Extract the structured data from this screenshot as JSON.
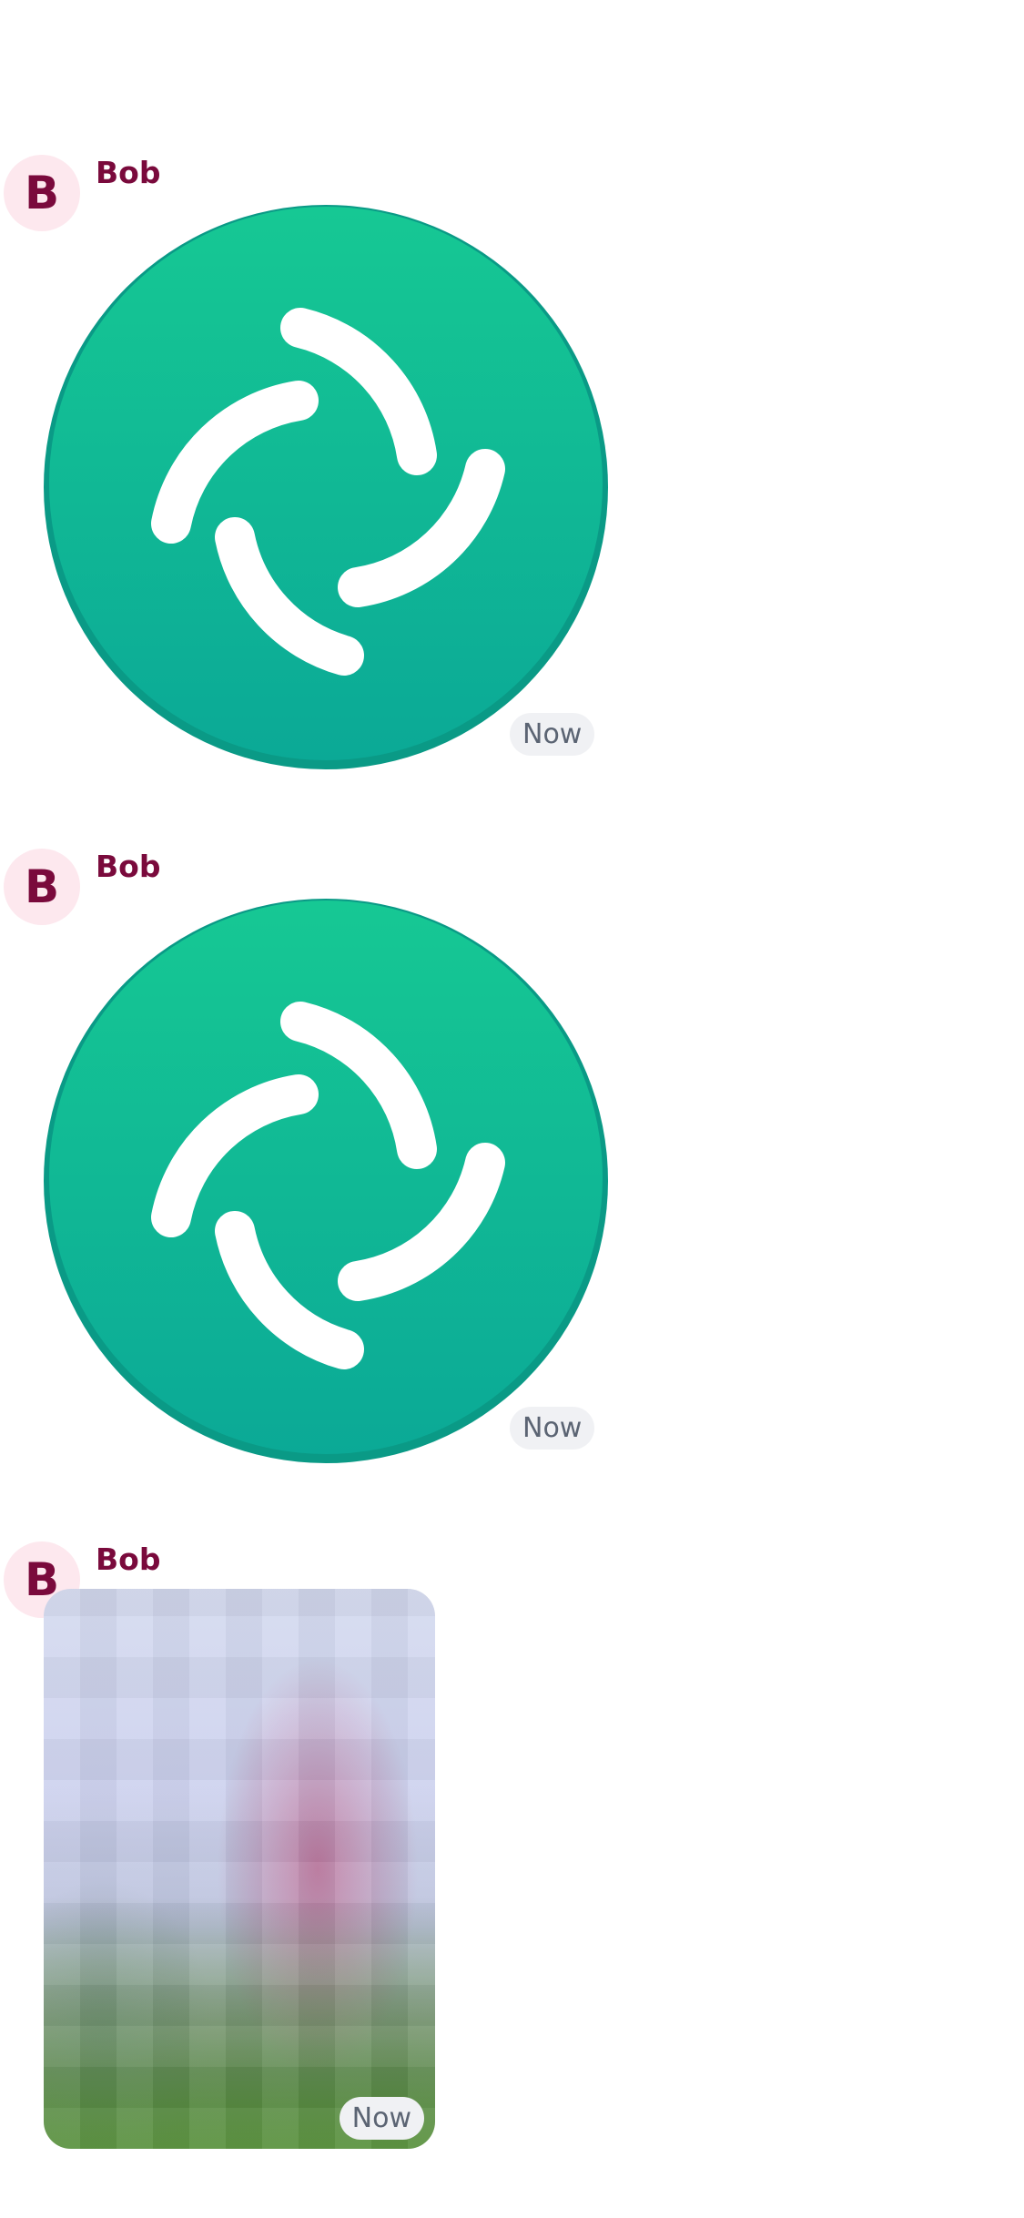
{
  "messages": [
    {
      "sender_initial": "B",
      "sender_name": "Bob",
      "kind": "logo",
      "time": "Now"
    },
    {
      "sender_initial": "B",
      "sender_name": "Bob",
      "kind": "logo",
      "time": "Now"
    },
    {
      "sender_initial": "B",
      "sender_name": "Bob",
      "kind": "photo",
      "time": "Now"
    }
  ],
  "colors": {
    "sender": "#7a0a3c",
    "avatar_bg": "#fde8ee",
    "logo_green": "#0dbd8b",
    "timestamp_bg": "#f0f1f4",
    "timestamp_text": "#5b6473"
  }
}
